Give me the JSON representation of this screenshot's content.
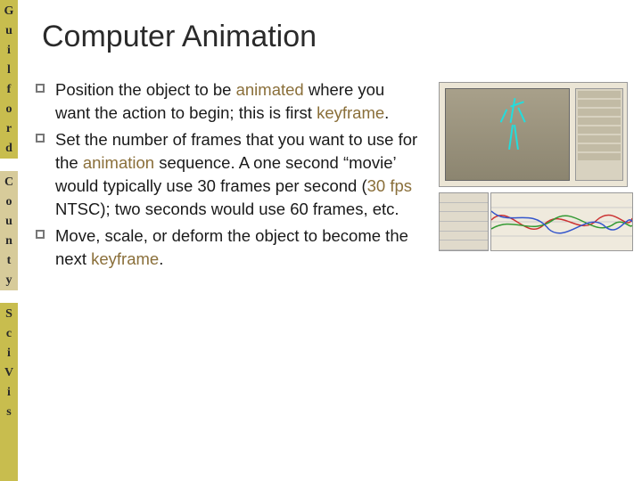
{
  "sidebar": {
    "guilford": [
      "G",
      "u",
      "i",
      "l",
      "f",
      "o",
      "r",
      "d"
    ],
    "county": [
      "C",
      "o",
      "u",
      "n",
      "t",
      "y"
    ],
    "scivis": [
      "S",
      "c",
      "i",
      "V",
      "i",
      "s"
    ]
  },
  "title": "Computer Animation",
  "bullets": [
    {
      "segments": [
        {
          "t": "Position the object to be ",
          "hl": false
        },
        {
          "t": "animated",
          "hl": true
        },
        {
          "t": " where you want the action to begin; this is first ",
          "hl": false
        },
        {
          "t": "keyframe",
          "hl": true
        },
        {
          "t": ".",
          "hl": false
        }
      ]
    },
    {
      "segments": [
        {
          "t": "Set the number of frames that you want to use for the ",
          "hl": false
        },
        {
          "t": "animation",
          "hl": true
        },
        {
          "t": " sequence.  A one second “movie’ would typically use 30 frames per second (",
          "hl": false
        },
        {
          "t": "30 fps",
          "hl": true
        },
        {
          "t": " NTSC); two seconds would use 60 frames, etc.",
          "hl": false
        }
      ]
    },
    {
      "segments": [
        {
          "t": "Move, scale, or deform the object to become the next ",
          "hl": false
        },
        {
          "t": "keyframe",
          "hl": true
        },
        {
          "t": ".",
          "hl": false
        }
      ]
    }
  ]
}
